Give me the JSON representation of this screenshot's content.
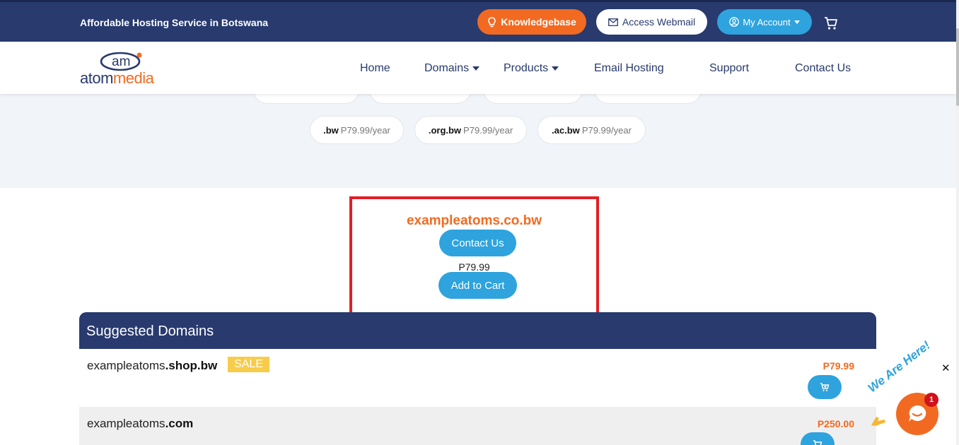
{
  "topbar": {
    "tagline": "Affordable Hosting Service in Botswana",
    "knowledgebase_label": "Knowledgebase",
    "webmail_label": "Access Webmail",
    "account_label": "My Account"
  },
  "logo": {
    "mark": "am",
    "word_part1": "atom",
    "word_part2": "media"
  },
  "nav": {
    "home": "Home",
    "domains": "Domains",
    "products": "Products",
    "email_hosting": "Email Hosting",
    "support": "Support",
    "contact": "Contact Us"
  },
  "tlds": [
    {
      "ext": ".bw",
      "price": "P79.99/year"
    },
    {
      "ext": ".org.bw",
      "price": "P79.99/year"
    },
    {
      "ext": ".ac.bw",
      "price": "P79.99/year"
    }
  ],
  "result": {
    "domain": "exampleatoms.co.bw",
    "contact_label": "Contact Us",
    "price": "P79.99",
    "add_label": "Add to Cart"
  },
  "suggested": {
    "title": "Suggested Domains",
    "rows": [
      {
        "name": "exampleatoms",
        "ext": ".shop.bw",
        "badge": "SALE",
        "price": "P79.99"
      },
      {
        "name": "exampleatoms",
        "ext": ".com",
        "badge": "",
        "price": "P250.00"
      }
    ]
  },
  "chat": {
    "label": "We Are Here!",
    "badge_count": "1",
    "close": "✕"
  },
  "colors": {
    "navy": "#283a6e",
    "orange": "#f26a21",
    "blue": "#2ea3dd",
    "red": "#e01e26",
    "sale": "#f7cc4a"
  }
}
